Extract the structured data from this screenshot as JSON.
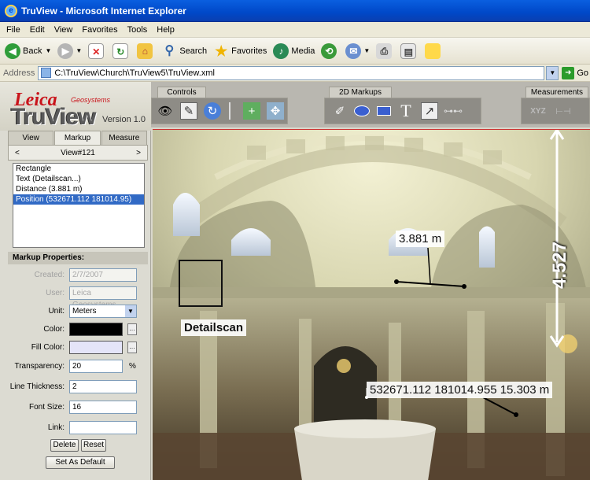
{
  "window": {
    "title": "TruView - Microsoft Internet Explorer"
  },
  "menu": [
    "File",
    "Edit",
    "View",
    "Favorites",
    "Tools",
    "Help"
  ],
  "toolbar": {
    "back": "Back",
    "search": "Search",
    "favorites": "Favorites",
    "media": "Media"
  },
  "address": {
    "label": "Address",
    "url": "C:\\TruView\\Church\\TruView5\\TruView.xml",
    "go": "Go"
  },
  "brand": {
    "leica": "Leica",
    "geosystems": "Geosystems",
    "product": "TruView",
    "version": "Version 1.0"
  },
  "tabs": [
    "View",
    "Markup",
    "Measure"
  ],
  "view_nav": {
    "prev": "<",
    "label": "View#121",
    "next": ">"
  },
  "markup_list": [
    "Rectangle",
    "Text (Detailscan...)",
    "Distance (3.881 m)",
    "Position (532671.112 181014.95)"
  ],
  "selected_markup_index": 3,
  "props": {
    "title": "Markup Properties:",
    "created_label": "Created:",
    "created_value": "2/7/2007",
    "user_label": "User:",
    "user_value": "Leica Geosystems",
    "unit_label": "Unit:",
    "unit_value": "Meters",
    "color_label": "Color:",
    "color_value": "#000000",
    "fill_label": "Fill Color:",
    "fill_value": "#e4e4f8",
    "transparency_label": "Transparency:",
    "transparency_value": "20",
    "transparency_unit": "%",
    "thickness_label": "Line Thickness:",
    "thickness_value": "2",
    "font_label": "Font Size:",
    "font_value": "16",
    "link_label": "Link:",
    "link_value": "",
    "delete_btn": "Delete",
    "reset_btn": "Reset",
    "default_btn": "Set As Default"
  },
  "panels": {
    "controls": "Controls",
    "markups": "2D Markups",
    "measurements": "Measurements",
    "xyz": "XYZ"
  },
  "viewer": {
    "distance_label": "3.881 m",
    "detailscan_label": "Detailscan",
    "position_label": "532671.112  181014.955  15.303 m",
    "height_label": "4.527"
  }
}
